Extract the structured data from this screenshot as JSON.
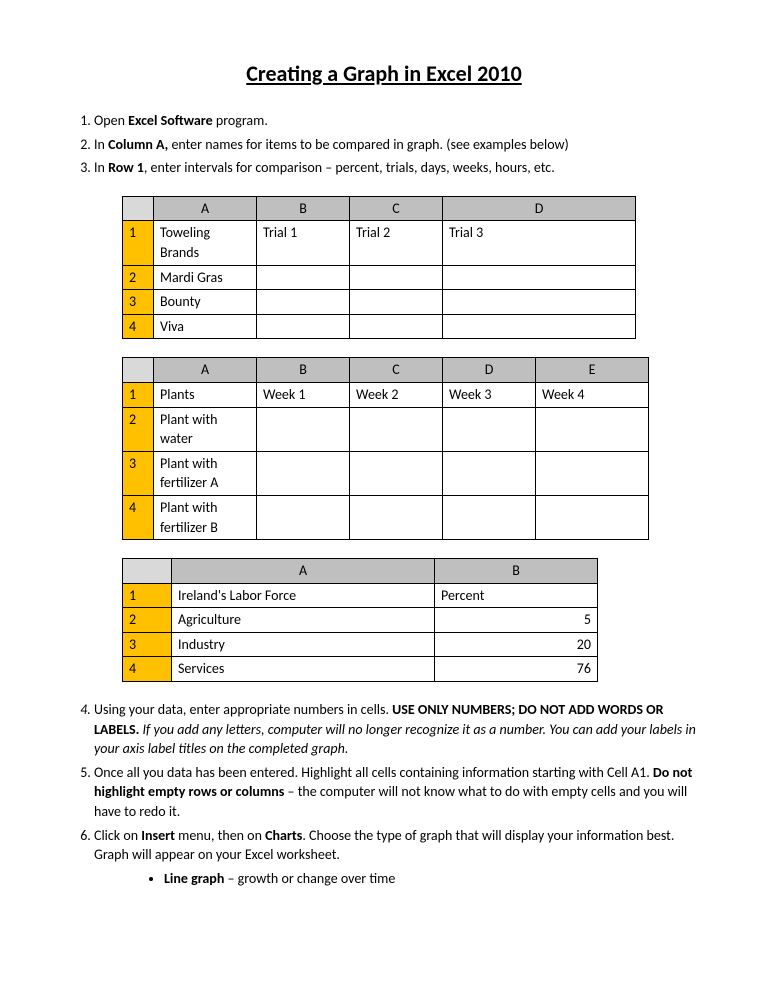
{
  "title": "Creating a Graph in Excel 2010",
  "step1": {
    "pre": "Open ",
    "bold": "Excel Software",
    "post": " program."
  },
  "step2": {
    "pre": "In ",
    "bold": "Column A,",
    "post": " enter names for items to be compared in graph. (see examples below)"
  },
  "step3": {
    "pre": "In ",
    "bold": "Row 1",
    "post": ", enter intervals for comparison – percent, trials, days, weeks, hours, etc."
  },
  "table1": {
    "cols": [
      "A",
      "B",
      "C",
      "D"
    ],
    "rows": [
      {
        "n": "1",
        "cells": [
          "Toweling Brands",
          "Trial 1",
          "Trial 2",
          "Trial 3"
        ]
      },
      {
        "n": "2",
        "cells": [
          "Mardi Gras",
          "",
          "",
          ""
        ]
      },
      {
        "n": "3",
        "cells": [
          "Bounty",
          "",
          "",
          ""
        ]
      },
      {
        "n": "4",
        "cells": [
          "Viva",
          "",
          "",
          ""
        ]
      }
    ]
  },
  "table2": {
    "cols": [
      "A",
      "B",
      "C",
      "D",
      "E"
    ],
    "rows": [
      {
        "n": "1",
        "cells": [
          "Plants",
          "Week 1",
          "Week 2",
          "Week 3",
          "Week 4"
        ]
      },
      {
        "n": "2",
        "cells": [
          "Plant with water",
          "",
          "",
          "",
          ""
        ]
      },
      {
        "n": "3",
        "cells": [
          "Plant with fertilizer A",
          "",
          "",
          "",
          ""
        ]
      },
      {
        "n": "4",
        "cells": [
          "Plant with fertilizer B",
          "",
          "",
          "",
          ""
        ]
      }
    ]
  },
  "table3": {
    "cols": [
      "A",
      "B"
    ],
    "rows": [
      {
        "n": "1",
        "cells": [
          "Ireland's Labor Force",
          "Percent"
        ]
      },
      {
        "n": "2",
        "cells": [
          "Agriculture",
          "5"
        ]
      },
      {
        "n": "3",
        "cells": [
          "Industry",
          "20"
        ]
      },
      {
        "n": "4",
        "cells": [
          "Services",
          "76"
        ]
      }
    ]
  },
  "step4": {
    "pre": "Using your data, enter appropriate numbers in cells.  ",
    "bold": "USE ONLY NUMBERS; DO NOT ADD WORDS OR LABELS.",
    "italic": "  If you add any letters, computer will no longer recognize it as a number.  You can add your labels in your axis label titles on the completed graph."
  },
  "step5": {
    "pre": "Once all you data has been entered.  Highlight all cells containing information starting with Cell A1.  ",
    "bold": "Do not highlight empty rows or columns",
    "post": " – the computer will not know what to do with empty cells and you will have to redo it."
  },
  "step6": {
    "pre": "Click on ",
    "bold1": "Insert",
    "mid": " menu, then on ",
    "bold2": "Charts",
    "post": ".  Choose the type of graph that will display your information best.  Graph will appear on your Excel worksheet."
  },
  "bullet1": {
    "bold": "Line graph",
    "post": " – growth or change over time"
  }
}
